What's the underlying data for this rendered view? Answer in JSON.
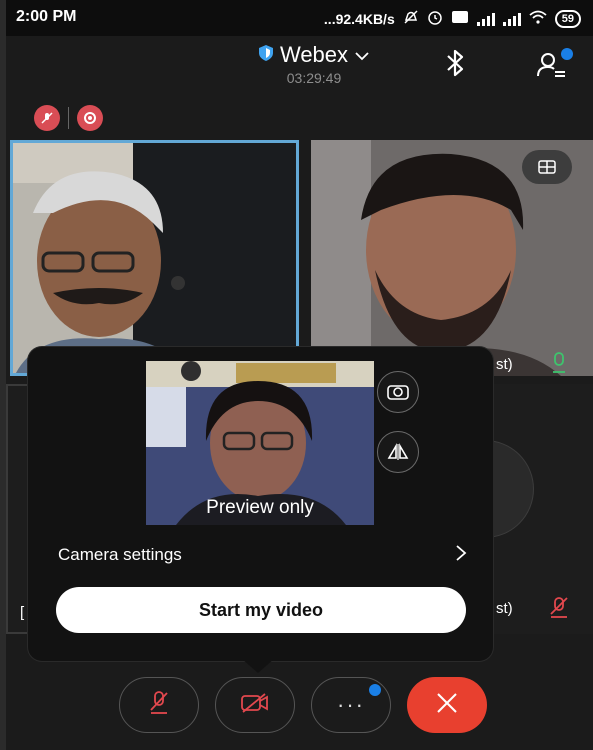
{
  "status_bar": {
    "time": "2:00 PM",
    "network_speed": "...92.4KB/s",
    "battery": "59"
  },
  "header": {
    "title": "Webex",
    "timer": "03:29:49"
  },
  "participants": {
    "tile3_label_fragment": "[",
    "tile2_label_fragment": "st)",
    "tile4_label_fragment": "st)"
  },
  "preview_popup": {
    "preview_label": "Preview only",
    "camera_settings_label": "Camera settings",
    "start_video_label": "Start my video"
  },
  "colors": {
    "accent_blue": "#1a7fe6",
    "end_call_red": "#e8402f",
    "recording_red": "#d94d55",
    "active_speaker_border": "#63a8d6"
  },
  "icons": [
    "shield-icon",
    "chevron-down-icon",
    "bluetooth-icon",
    "participants-icon",
    "mute-indicator-icon",
    "record-icon",
    "layout-grid-icon",
    "switch-camera-icon",
    "mirror-icon",
    "chevron-right-icon",
    "mic-muted-icon",
    "video-off-icon",
    "more-icon",
    "end-call-icon"
  ]
}
